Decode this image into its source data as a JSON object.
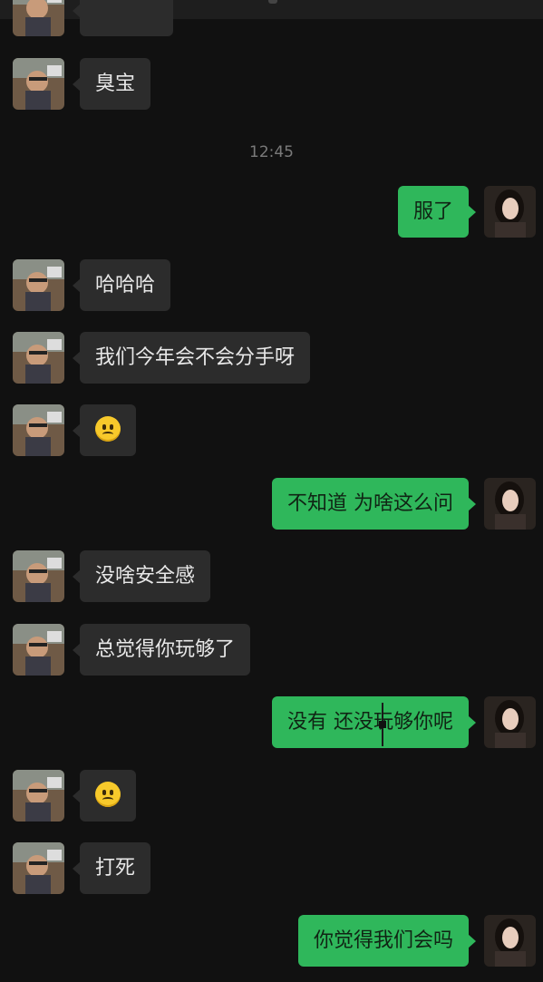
{
  "topbar": {
    "back_glyph": "‹"
  },
  "timestamp": "12:45",
  "messages": [
    {
      "from": "in",
      "text": "",
      "note": "partially visible"
    },
    {
      "from": "in",
      "text": "臭宝"
    },
    {
      "from": "out",
      "text": "服了"
    },
    {
      "from": "in",
      "text": "哈哈哈"
    },
    {
      "from": "in",
      "text": "我们今年会不会分手呀"
    },
    {
      "from": "in",
      "text": "",
      "emoji": "frowning-face-icon"
    },
    {
      "from": "out",
      "text": "不知道 为啥这么问"
    },
    {
      "from": "in",
      "text": "没啥安全感"
    },
    {
      "from": "in",
      "text": "总觉得你玩够了"
    },
    {
      "from": "out",
      "text": "没有 还没玩够你呢"
    },
    {
      "from": "in",
      "text": "",
      "emoji": "frowning-face-icon"
    },
    {
      "from": "in",
      "text": "打死"
    },
    {
      "from": "out",
      "text": "你觉得我们会吗"
    }
  ],
  "colors": {
    "background": "#111111",
    "incoming_bubble": "#2c2c2c",
    "outgoing_bubble": "#2fb75b",
    "timestamp": "#7a7a7a"
  }
}
